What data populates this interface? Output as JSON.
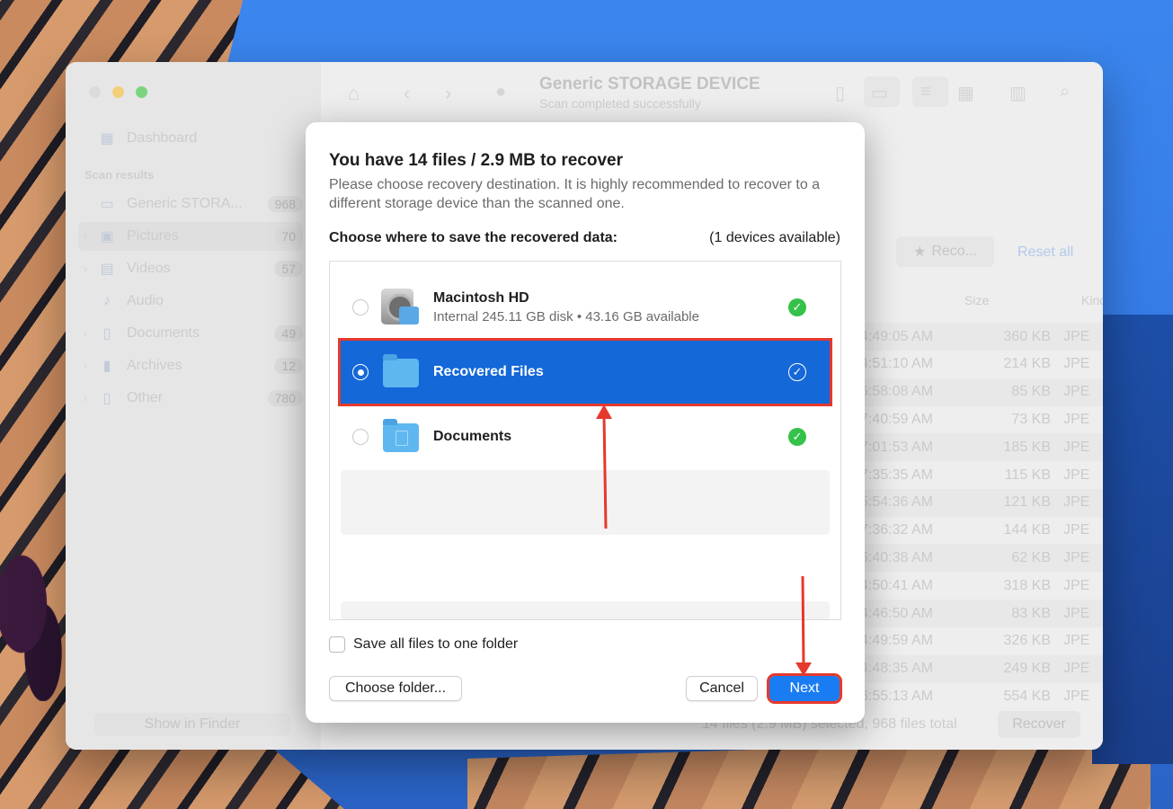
{
  "window": {
    "title": "Generic STORAGE DEVICE",
    "subtitle": "Scan completed successfully"
  },
  "sidebar": {
    "dashboard": "Dashboard",
    "section_heading": "Scan results",
    "items": [
      {
        "label": "Generic STORA...",
        "count": "968",
        "icon": "drive-icon"
      },
      {
        "label": "Pictures",
        "count": "70",
        "icon": "pictures-icon"
      },
      {
        "label": "Videos",
        "count": "57",
        "icon": "video-icon"
      },
      {
        "label": "Audio",
        "count": "",
        "icon": "music-icon"
      },
      {
        "label": "Documents",
        "count": "49",
        "icon": "document-icon"
      },
      {
        "label": "Archives",
        "count": "12",
        "icon": "archive-icon"
      },
      {
        "label": "Other",
        "count": "780",
        "icon": "other-icon"
      }
    ],
    "show_in_finder": "Show in Finder"
  },
  "main": {
    "filter_button": "Reco...",
    "reset_all": "Reset all",
    "columns": {
      "size": "Size",
      "kind": "Kind"
    },
    "rows": [
      {
        "time": "4:49:05 AM",
        "size": "360 KB",
        "kind": "JPE"
      },
      {
        "time": "4:51:10 AM",
        "size": "214 KB",
        "kind": "JPE"
      },
      {
        "time": "6:58:08 AM",
        "size": "85 KB",
        "kind": "JPE"
      },
      {
        "time": "7:40:59 AM",
        "size": "73 KB",
        "kind": "JPE"
      },
      {
        "time": "7:01:53 AM",
        "size": "185 KB",
        "kind": "JPE"
      },
      {
        "time": "7:35:35 AM",
        "size": "115 KB",
        "kind": "JPE"
      },
      {
        "time": "5:54:36 AM",
        "size": "121 KB",
        "kind": "JPE"
      },
      {
        "time": "7:36:32 AM",
        "size": "144 KB",
        "kind": "JPE"
      },
      {
        "time": "6:40:38 AM",
        "size": "62 KB",
        "kind": "JPE"
      },
      {
        "time": "4:50:41 AM",
        "size": "318 KB",
        "kind": "JPE"
      },
      {
        "time": "4:46:50 AM",
        "size": "83 KB",
        "kind": "JPE"
      },
      {
        "time": "4:49:59 AM",
        "size": "326 KB",
        "kind": "JPE"
      },
      {
        "time": "4:48:35 AM",
        "size": "249 KB",
        "kind": "JPE"
      },
      {
        "time": "6:55:13 AM",
        "size": "554 KB",
        "kind": "JPE"
      }
    ],
    "status": "14 files (2.9 MB) selected, 968 files total",
    "recover_button": "Recover"
  },
  "dialog": {
    "title": "You have 14 files / 2.9 MB to recover",
    "description": "Please choose recovery destination. It is highly recommended to recover to a different storage device than the scanned one.",
    "choose_label": "Choose where to save the recovered data:",
    "devices_available": "(1 devices available)",
    "destinations": [
      {
        "name": "Macintosh HD",
        "detail": "Internal 245.11 GB disk • 43.16 GB available",
        "selected": false
      },
      {
        "name": "Recovered Files",
        "detail": "",
        "selected": true
      },
      {
        "name": "Documents",
        "detail": "",
        "selected": false
      }
    ],
    "save_one_folder": "Save all files to one folder",
    "choose_folder": "Choose folder...",
    "cancel": "Cancel",
    "next": "Next"
  },
  "colors": {
    "accent": "#1468d8",
    "annotation": "#e5392d",
    "success": "#35c24a"
  }
}
